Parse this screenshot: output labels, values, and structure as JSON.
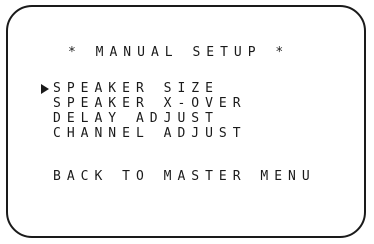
{
  "screen": {
    "title": "* MANUAL SETUP *",
    "cursor_icon": "triangle-right-icon",
    "menu": [
      {
        "label": "SPEAKER SIZE",
        "selected": true
      },
      {
        "label": "SPEAKER X-OVER",
        "selected": false
      },
      {
        "label": "DELAY ADJUST",
        "selected": false
      },
      {
        "label": "CHANNEL ADJUST",
        "selected": false
      }
    ],
    "back_label": "BACK TO MASTER MENU"
  }
}
